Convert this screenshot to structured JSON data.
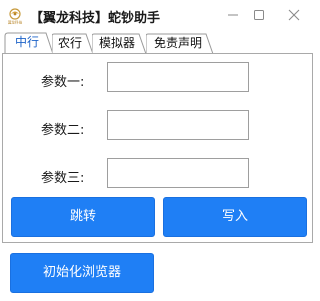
{
  "window": {
    "title": "【翼龙科技】蛇钞助手",
    "logo_caption": "翼龙科技",
    "minimize_glyph": "—",
    "maximize_glyph": "☐",
    "close_glyph": "✕"
  },
  "tabs": [
    {
      "label": "中行",
      "active": true
    },
    {
      "label": "农行",
      "active": false
    },
    {
      "label": "模拟器",
      "active": false
    },
    {
      "label": "免责声明",
      "active": false
    }
  ],
  "form": {
    "param1_label": "参数一:",
    "param1_value": "",
    "param2_label": "参数二:",
    "param2_value": "",
    "param3_label": "参数三:",
    "param3_value": ""
  },
  "actions": {
    "jump_label": "跳转",
    "write_label": "写入",
    "init_browser_label": "初始化浏览器"
  },
  "colors": {
    "button_blue": "#1f7ff5",
    "active_tab_text": "#1e63c8"
  },
  "icons": {
    "app": "dragon-logo-icon",
    "minimize": "minimize-icon",
    "maximize": "maximize-icon",
    "close": "close-icon"
  }
}
